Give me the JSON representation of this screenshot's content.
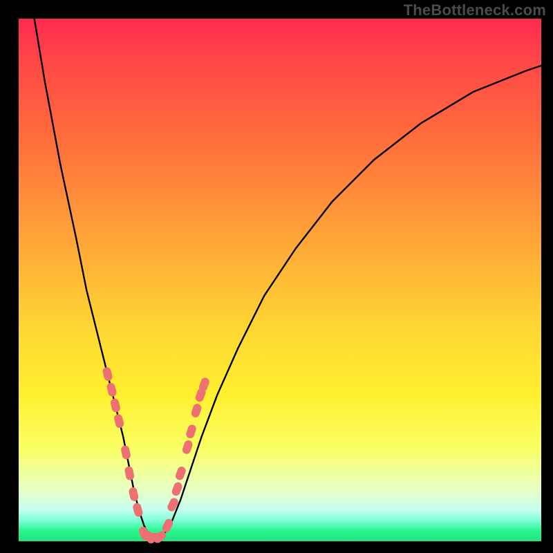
{
  "watermark": "TheBottleneck.com",
  "chart_data": {
    "type": "line",
    "title": "",
    "xlabel": "",
    "ylabel": "",
    "xlim": [
      0,
      100
    ],
    "ylim": [
      0,
      100
    ],
    "series": [
      {
        "name": "bottleneck-curve",
        "x": [
          3,
          5,
          8,
          11,
          13,
          15,
          17,
          18.5,
          20,
          21,
          22,
          23,
          24,
          25,
          26,
          27.5,
          29,
          31,
          33,
          35,
          38,
          42,
          47,
          53,
          60,
          68,
          77,
          87,
          97,
          100
        ],
        "y": [
          100,
          88,
          72,
          58,
          48,
          40,
          32,
          26,
          20,
          15,
          10,
          6,
          3,
          1,
          0.5,
          1,
          3,
          8,
          14,
          20,
          28,
          37,
          47,
          56,
          65,
          73,
          80,
          86,
          90,
          91
        ]
      }
    ],
    "markers": {
      "name": "highlight-points",
      "color": "#ed7172",
      "points": [
        {
          "x": 17.0,
          "y": 32
        },
        {
          "x": 17.8,
          "y": 29
        },
        {
          "x": 18.5,
          "y": 26
        },
        {
          "x": 19.2,
          "y": 23
        },
        {
          "x": 20.5,
          "y": 17
        },
        {
          "x": 21.2,
          "y": 13
        },
        {
          "x": 22.0,
          "y": 9
        },
        {
          "x": 22.8,
          "y": 6
        },
        {
          "x": 24.0,
          "y": 1.5
        },
        {
          "x": 25.0,
          "y": 0.8
        },
        {
          "x": 26.0,
          "y": 0.8
        },
        {
          "x": 27.0,
          "y": 0.8
        },
        {
          "x": 28.5,
          "y": 3
        },
        {
          "x": 29.5,
          "y": 7
        },
        {
          "x": 30.3,
          "y": 10
        },
        {
          "x": 31.0,
          "y": 13
        },
        {
          "x": 32.3,
          "y": 18
        },
        {
          "x": 33.0,
          "y": 21
        },
        {
          "x": 34.0,
          "y": 25
        },
        {
          "x": 34.8,
          "y": 28
        },
        {
          "x": 35.5,
          "y": 30
        }
      ]
    }
  }
}
